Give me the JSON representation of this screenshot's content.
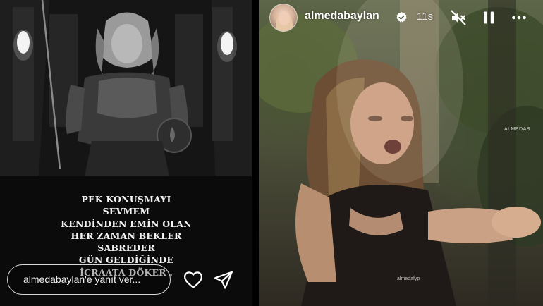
{
  "left_story": {
    "quote_lines": [
      "PEK KONUŞMAYI",
      "SEVMEM",
      "KENDİNDEN EMİN OLAN",
      "HER ZAMAN BEKLER",
      "SABREDER",
      "GÜN GELDİĞİNDE",
      "İCRAATA DÖKER ."
    ],
    "reply_placeholder": "almedabaylan'e yanıt ver...",
    "like_icon": "heart-icon",
    "share_icon": "send-icon"
  },
  "right_story": {
    "username": "almedabaylan",
    "verified_icon": "verified-badge-icon",
    "time_ago": "11s",
    "mute_icon": "muted-speaker-icon",
    "pause_icon": "pause-icon",
    "more_icon": "more-horizontal-icon",
    "watermark": "almedafyp",
    "edge_logo": "ALMEDAB"
  },
  "colors": {
    "text": "#ffffff",
    "input_border": "#d8d8d8",
    "verified_blue": "#ffffff"
  }
}
